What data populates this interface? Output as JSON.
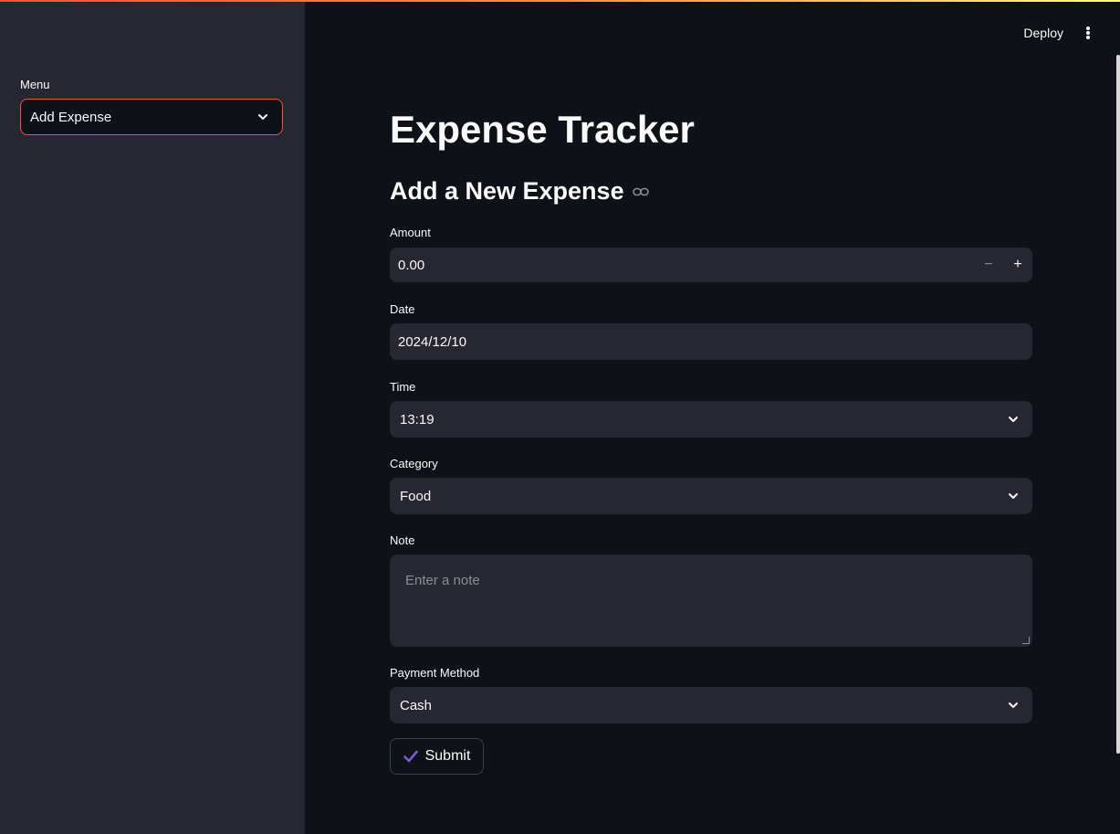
{
  "sidebar": {
    "menu_label": "Menu",
    "menu_selected": "Add Expense"
  },
  "header": {
    "deploy_label": "Deploy"
  },
  "main": {
    "title": "Expense Tracker",
    "subtitle": "Add a New Expense",
    "amount": {
      "label": "Amount",
      "value": "0.00",
      "minus": "−",
      "plus": "+"
    },
    "date": {
      "label": "Date",
      "value": "2024/12/10"
    },
    "time": {
      "label": "Time",
      "value": "13:19"
    },
    "category": {
      "label": "Category",
      "value": "Food"
    },
    "note": {
      "label": "Note",
      "placeholder": "Enter a note"
    },
    "payment": {
      "label": "Payment Method",
      "value": "Cash"
    },
    "submit_label": "Submit"
  },
  "colors": {
    "accent": "#ff4b4b",
    "submit_check": "#7c5cd6",
    "background": "#0e1117",
    "sidebar": "#262730"
  },
  "icons": [
    "chevron-down-icon",
    "link-icon",
    "check-icon",
    "kebab-menu-icon"
  ]
}
